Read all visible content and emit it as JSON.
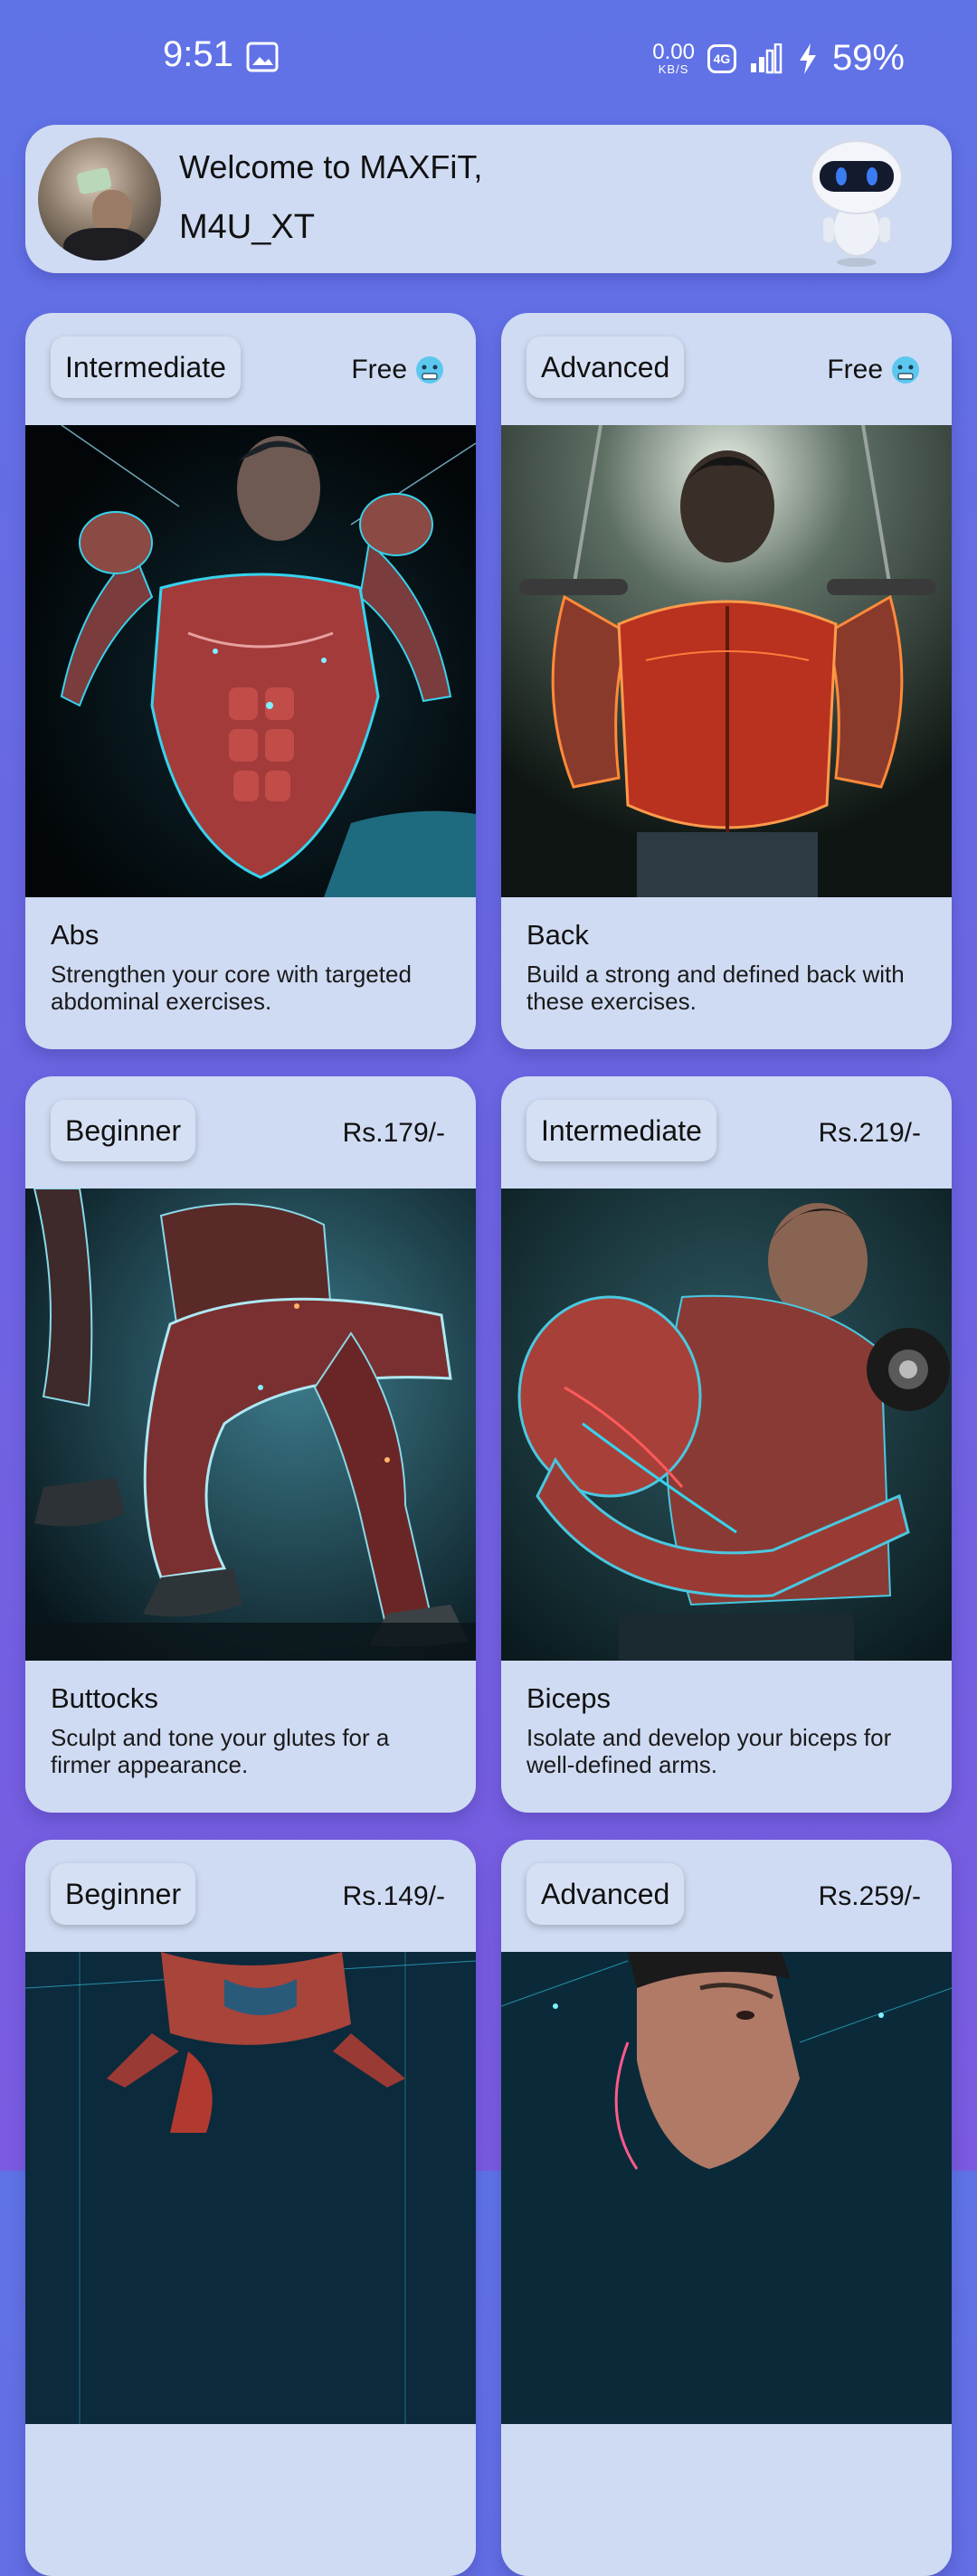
{
  "status_bar": {
    "time": "9:51",
    "net_speed": "0.00",
    "net_speed_unit": "KB/S",
    "network": "4G",
    "battery": "59%"
  },
  "header": {
    "welcome": "Welcome to MAXFiT,",
    "username": "M4U_XT"
  },
  "workouts": [
    {
      "level": "Intermediate",
      "price": "Free",
      "title": "Abs",
      "description": "Strengthen your core with targeted abdominal exercises.",
      "image_icon": "abs-muscle-figure"
    },
    {
      "level": "Advanced",
      "price": "Free",
      "title": "Back",
      "description": "Build a strong and defined back with these exercises.",
      "image_icon": "back-muscle-figure"
    },
    {
      "level": "Beginner",
      "price": "Rs.179/-",
      "title": "Buttocks",
      "description": "Sculpt and tone your glutes for a firmer appearance.",
      "image_icon": "legs-muscle-figure"
    },
    {
      "level": "Intermediate",
      "price": "Rs.219/-",
      "title": "Biceps",
      "description": "Isolate and develop your biceps for well-defined arms.",
      "image_icon": "biceps-muscle-figure"
    },
    {
      "level": "Beginner",
      "price": "Rs.149/-",
      "title": "",
      "description": "",
      "image_icon": "glutes-muscle-figure"
    },
    {
      "level": "Advanced",
      "price": "Rs.259/-",
      "title": "",
      "description": "",
      "image_icon": "face-muscle-figure"
    }
  ],
  "colors": {
    "background_top": "#5f73e6",
    "background_bottom": "#7a5ae0",
    "card": "#cfdbf3",
    "muscle_red": "#b83a3a",
    "glow_cyan": "#37d3ee"
  }
}
